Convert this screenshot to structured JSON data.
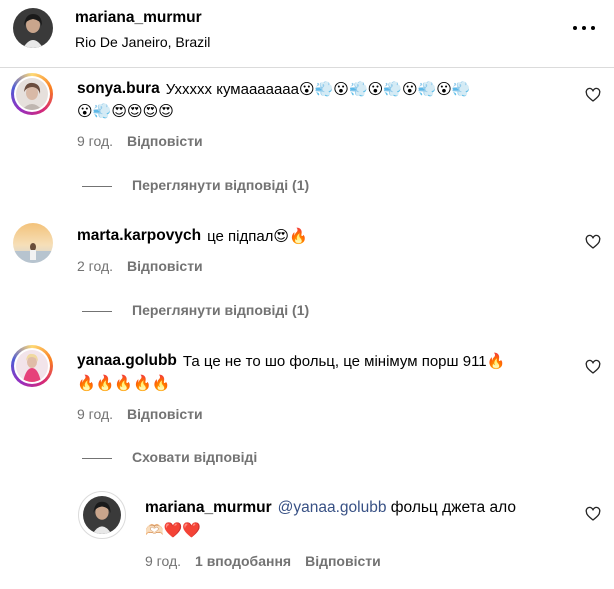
{
  "post": {
    "username": "mariana_murmur",
    "location": "Rio De Janeiro, Brazil"
  },
  "icons": {
    "more": "more-horizontal-icon",
    "like": "heart-outline-icon"
  },
  "comments": [
    {
      "username": "sonya.bura",
      "text_line1": "Ухxxxx кумааааааа😮💨😮💨😮💨😮💨😮💨",
      "text_line2": "😮💨😍😍😍😍",
      "time": "9 год.",
      "reply": "Відповісти",
      "view_replies": "Переглянути відповіді (1)"
    },
    {
      "username": "marta.karpovych",
      "text_line1": "це підпал😍🔥",
      "time": "2 год.",
      "reply": "Відповісти",
      "view_replies": "Переглянути відповіді (1)"
    },
    {
      "username": "yanaa.golubb",
      "text_line1": "Та це не то шо фольц, це мінімум порш 911🔥",
      "text_line2": "🔥🔥🔥🔥🔥",
      "time": "9 год.",
      "reply": "Відповісти",
      "hide_replies": "Сховати відповіді"
    }
  ],
  "reply": {
    "username": "mariana_murmur",
    "mention": "@yanaa.golubb",
    "text_line1": "фольц джета ало",
    "text_line2": "🫶🏻❤️❤️",
    "time": "9 год.",
    "likes": "1 вподобання",
    "reply": "Відповісти"
  },
  "colors": {
    "mention": "#385185",
    "secondary_text": "#737373",
    "heart_red": "#ed4956"
  }
}
